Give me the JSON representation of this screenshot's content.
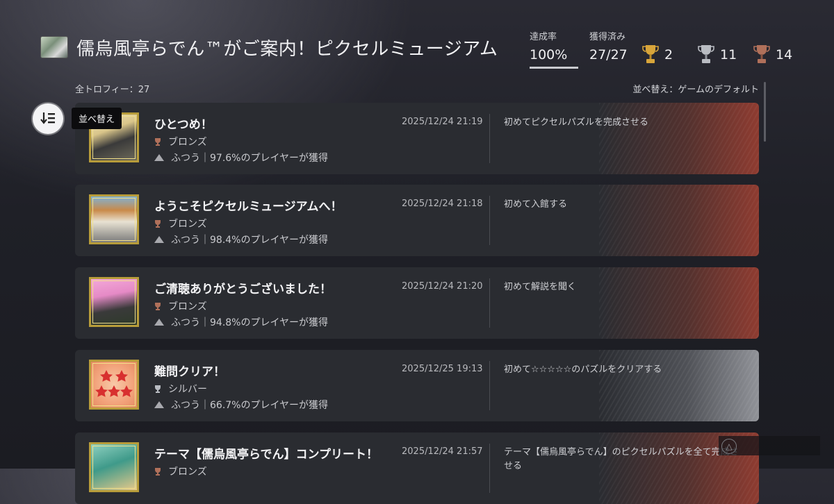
{
  "header": {
    "title": "儒烏風亭らでん™がご案内！ピクセルミュージアム"
  },
  "stats": {
    "rate_label": "達成率",
    "rate_value": "100%",
    "earned_label": "獲得済み",
    "earned_value": "27/27",
    "gold_count": "2",
    "silver_count": "11",
    "bronze_count": "14"
  },
  "toolbar": {
    "total_label": "全トロフィー：27",
    "sort_label": "並べ替え：ゲームのデフォルト",
    "sort_button_tooltip": "並べ替え"
  },
  "trophies": [
    {
      "name": "ひとつめ！",
      "grade": "ブロンズ",
      "rarity": "ふつう｜97.6%のプレイヤーが獲得",
      "date": "2025/12/24  21:19",
      "description": "初めてピクセルパズルを完成させる"
    },
    {
      "name": "ようこそピクセルミュージアムへ！",
      "grade": "ブロンズ",
      "rarity": "ふつう｜98.4%のプレイヤーが獲得",
      "date": "2025/12/24  21:18",
      "description": "初めて入館する"
    },
    {
      "name": "ご清聴ありがとうございました！",
      "grade": "ブロンズ",
      "rarity": "ふつう｜94.8%のプレイヤーが獲得",
      "date": "2025/12/24  21:20",
      "description": "初めて解説を聞く"
    },
    {
      "name": "難問クリア！",
      "grade": "シルバー",
      "rarity": "ふつう｜66.7%のプレイヤーが獲得",
      "date": "2025/12/25  19:13",
      "description": "初めて☆☆☆☆☆のパズルをクリアする"
    },
    {
      "name": "テーマ【儒烏風亭らでん】コンプリート！",
      "grade": "ブロンズ",
      "rarity": "",
      "date": "2025/12/24  21:57",
      "description": "テーマ【儒烏風亭らでん】のピクセルパズルを全て完成させる"
    }
  ],
  "colors": {
    "gold": "#d8a53a",
    "silver": "#b9bcc2",
    "bronze": "#b0705a",
    "background": "#1f2027"
  },
  "icons": {
    "sort": "sort-descending-icon",
    "corner": "triangle-button-icon"
  }
}
